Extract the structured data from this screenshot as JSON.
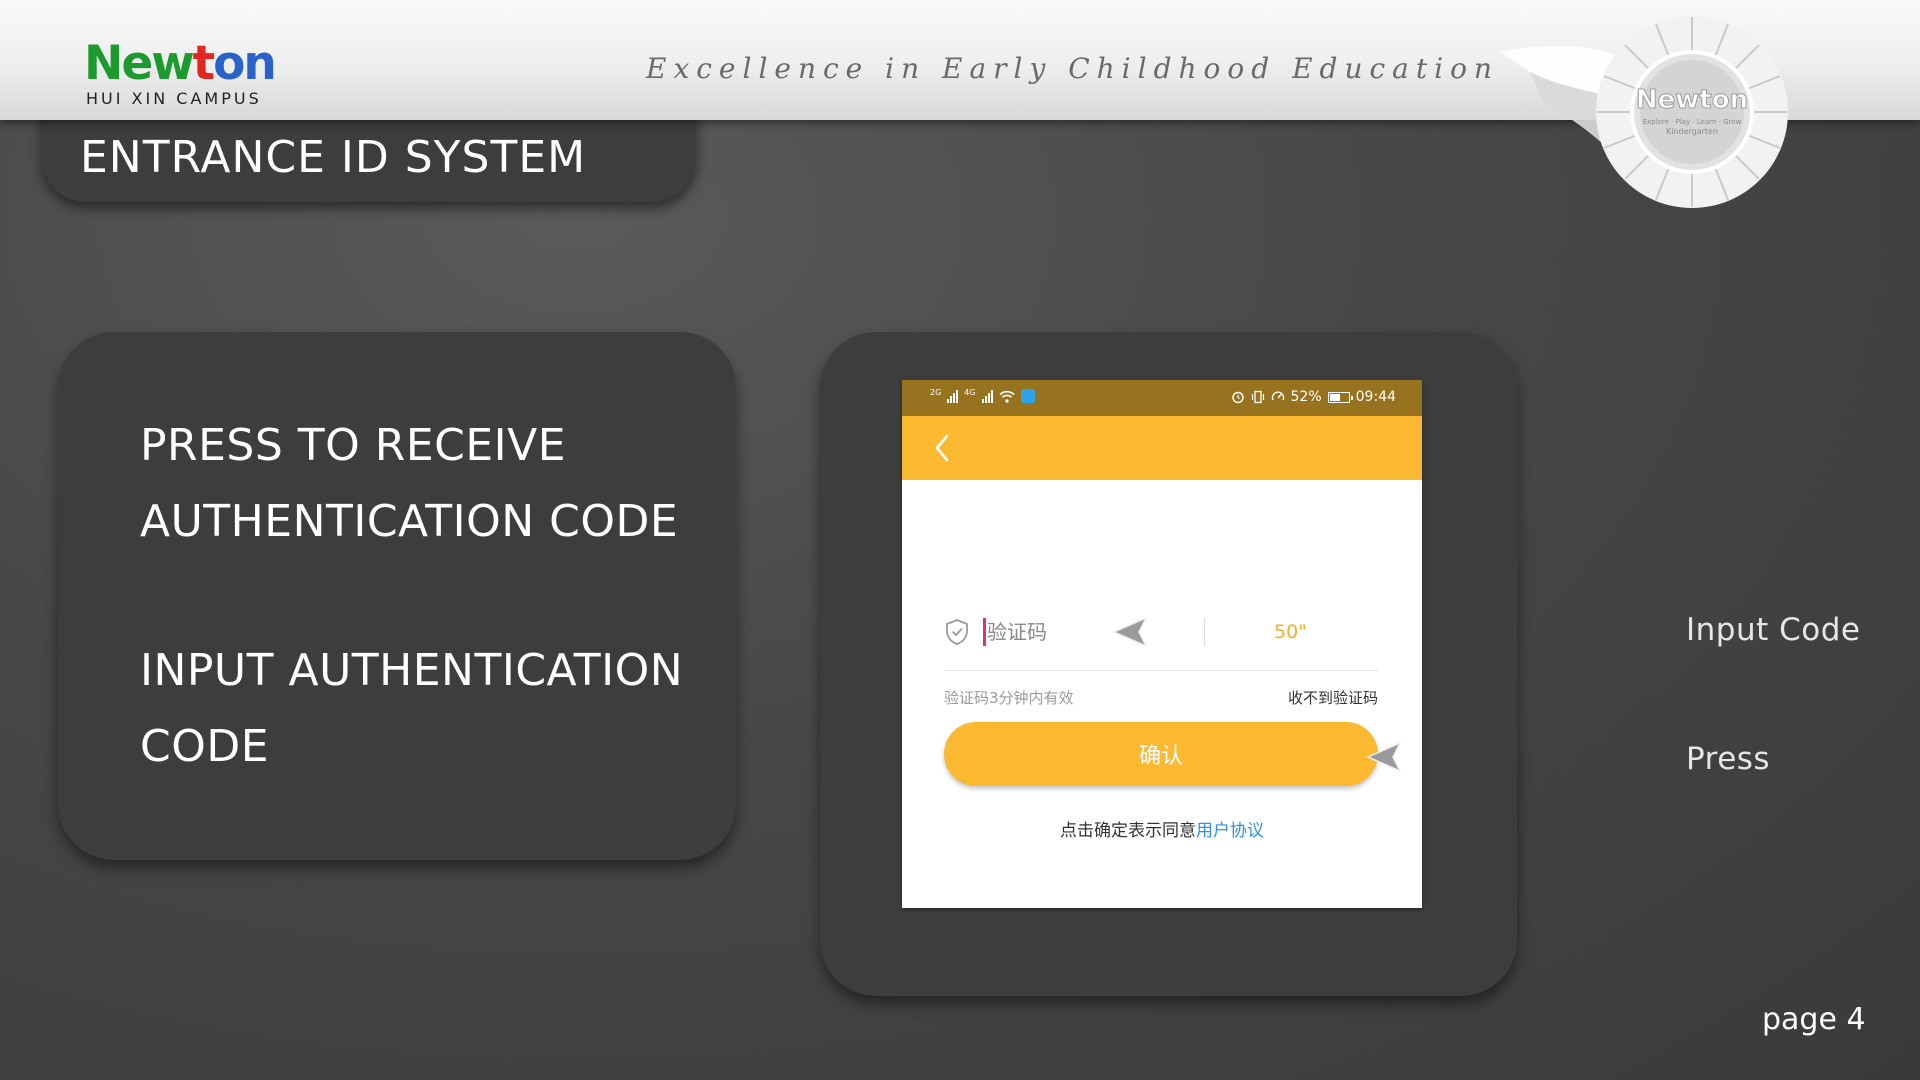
{
  "header": {
    "logo": {
      "letters": [
        {
          "char": "N",
          "color": "#1d9a2e"
        },
        {
          "char": "e",
          "color": "#1d9a2e"
        },
        {
          "char": "w",
          "color": "#1d9a2e"
        },
        {
          "char": "t",
          "color": "#e3261e"
        },
        {
          "char": "o",
          "color": "#2a62c9"
        },
        {
          "char": "n",
          "color": "#2a62c9"
        }
      ],
      "subtitle": "HUI XIN CAMPUS"
    },
    "tagline": "Excellence in Early Childhood Education",
    "seal": {
      "title": "Newton",
      "line1": "Explore · Play · Learn · Grow",
      "line2": "Kindergarten"
    }
  },
  "title": "ENTRANCE ID SYSTEM",
  "instructions": [
    "PRESS TO RECEIVE",
    "AUTHENTICATION CODE",
    "INPUT AUTHENTICATION",
    "CODE"
  ],
  "phone": {
    "status_bar": {
      "net1": "2G",
      "net2": "4G",
      "battery": "52%",
      "time": "09:44"
    },
    "code_input": {
      "placeholder": "验证码",
      "value": ""
    },
    "countdown": "50\"",
    "hint": "验证码3分钟内有效",
    "resend_link": "收不到验证码",
    "confirm_button": "确认",
    "agreement_text": "点击确定表示同意",
    "agreement_link": "用户协议"
  },
  "callouts": {
    "input": "Input Code",
    "press": "Press"
  },
  "page_label": "page 4",
  "colors": {
    "accent_yellow": "#fbb831",
    "status_bar": "#98731f",
    "panel": "#3d3d3d",
    "link_blue": "#2f8fe6"
  },
  "icons": [
    "shield-check-icon",
    "back-chevron-icon",
    "signal-icon",
    "wifi-icon",
    "alarm-icon",
    "vibrate-icon",
    "speed-icon",
    "battery-icon"
  ]
}
